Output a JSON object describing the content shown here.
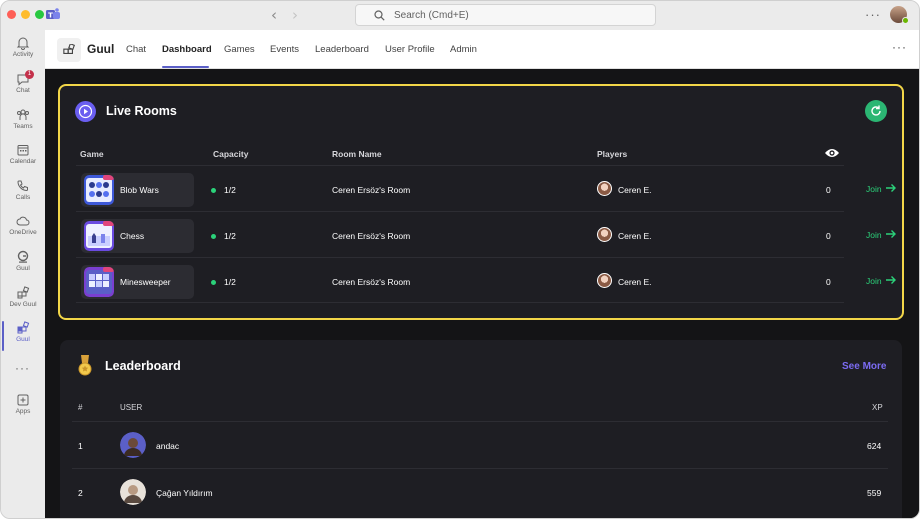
{
  "titlebar": {
    "search_placeholder": "Search (Cmd+E)"
  },
  "rail": {
    "items": [
      {
        "label": "Activity",
        "icon": "bell-icon"
      },
      {
        "label": "Chat",
        "icon": "chat-icon",
        "badge": "1"
      },
      {
        "label": "Teams",
        "icon": "teams-icon"
      },
      {
        "label": "Calendar",
        "icon": "calendar-icon"
      },
      {
        "label": "Calls",
        "icon": "phone-icon"
      },
      {
        "label": "OneDrive",
        "icon": "cloud-icon"
      },
      {
        "label": "Guul",
        "icon": "guul-icon"
      },
      {
        "label": "Dev Guul",
        "icon": "grid-icon"
      },
      {
        "label": "Guul",
        "icon": "grid-icon",
        "active": true
      },
      {
        "label": "Apps",
        "icon": "plus-box-icon"
      }
    ]
  },
  "app": {
    "name": "Guul",
    "tabs": [
      "Chat",
      "Dashboard",
      "Games",
      "Events",
      "Leaderboard",
      "User Profile",
      "Admin"
    ],
    "active_tab": "Dashboard"
  },
  "live_rooms": {
    "title": "Live Rooms",
    "columns": {
      "game": "Game",
      "capacity": "Capacity",
      "room_name": "Room Name",
      "players": "Players"
    },
    "rows": [
      {
        "game": "Blob Wars",
        "capacity": "1/2",
        "room_name": "Ceren Ersöz's Room",
        "player": "Ceren E.",
        "viewers": "0",
        "action": "Join"
      },
      {
        "game": "Chess",
        "capacity": "1/2",
        "room_name": "Ceren Ersöz's Room",
        "player": "Ceren E.",
        "viewers": "0",
        "action": "Join"
      },
      {
        "game": "Minesweeper",
        "capacity": "1/2",
        "room_name": "Ceren Ersöz's Room",
        "player": "Ceren E.",
        "viewers": "0",
        "action": "Join"
      }
    ],
    "accent_color": "#f2d648",
    "status_color": "#2bd27a"
  },
  "leaderboard": {
    "title": "Leaderboard",
    "see_more": "See More",
    "columns": {
      "rank": "#",
      "user": "USER",
      "xp": "XP"
    },
    "rows": [
      {
        "rank": "1",
        "user": "andac",
        "xp": "624"
      },
      {
        "rank": "2",
        "user": "Çağan Yıldırım",
        "xp": "559"
      }
    ]
  }
}
